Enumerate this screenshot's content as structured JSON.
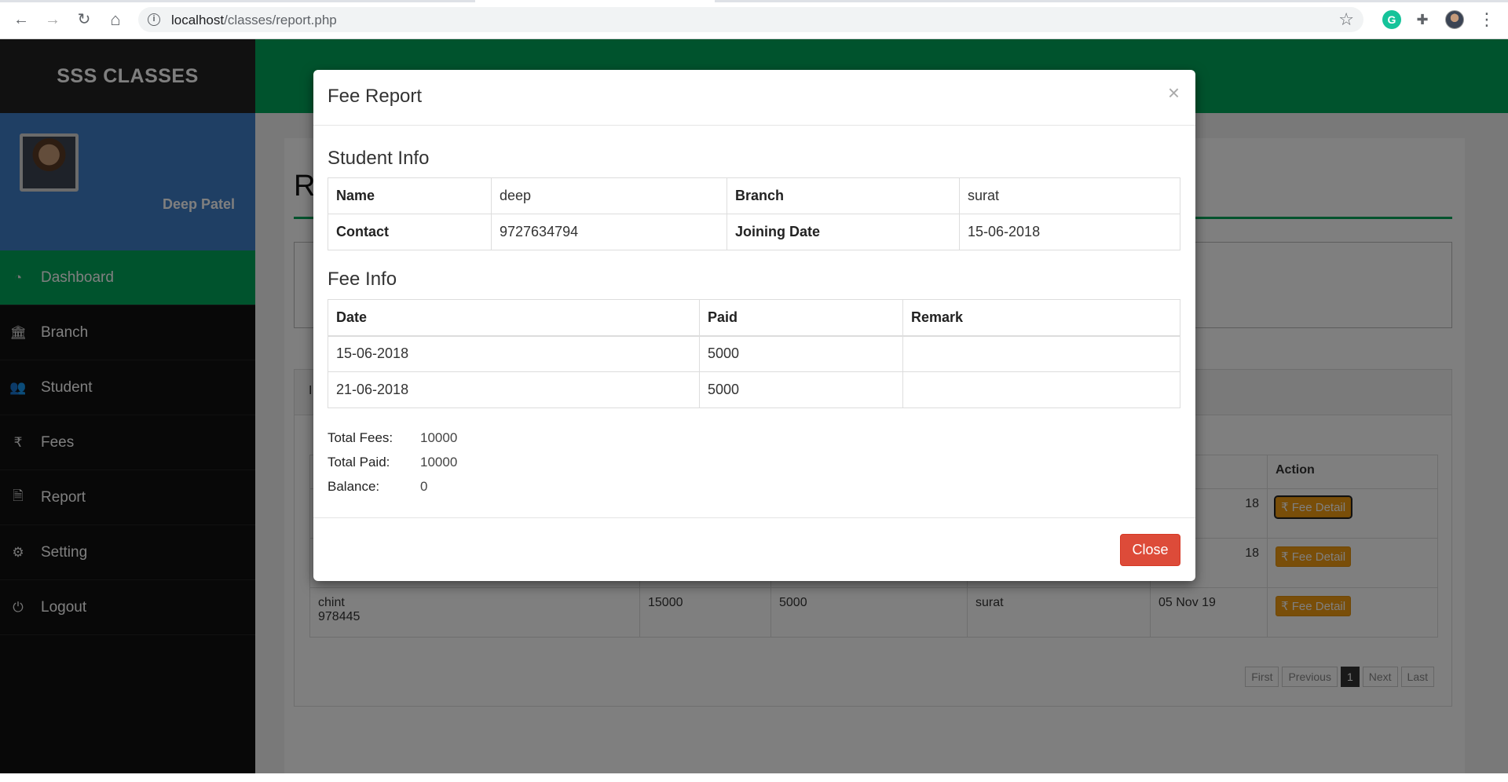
{
  "browser": {
    "url_host": "localhost",
    "url_path": "/classes/report.php",
    "back_icon": "←",
    "forward_icon": "→",
    "reload_icon": "↻",
    "home_icon": "⌂",
    "star_icon": "☆",
    "menu_icon": "⋮",
    "grammarly_label": "G",
    "extensions_icon": "✚"
  },
  "sidebar": {
    "brand": "SSS CLASSES",
    "user_name": "Deep Patel",
    "items": [
      {
        "label": "Dashboard",
        "icon": "◔"
      },
      {
        "label": "Branch",
        "icon": "🏛"
      },
      {
        "label": "Student",
        "icon": "👥"
      },
      {
        "label": "Fees",
        "icon": "₹"
      },
      {
        "label": "Report",
        "icon": "🗎"
      },
      {
        "label": "Setting",
        "icon": "⚙"
      },
      {
        "label": "Logout",
        "icon": "⏻"
      }
    ]
  },
  "background": {
    "page_title_initial": "R",
    "list_tab_initial": "I",
    "table_headers": [
      "",
      "",
      "",
      "",
      "",
      "Action"
    ],
    "rows": [
      {
        "name": "",
        "fees": "",
        "paid": "",
        "branch": "",
        "date": "18",
        "action": "Fee Detail"
      },
      {
        "name": "",
        "fees": "",
        "paid": "",
        "branch": "",
        "date": "18",
        "action": "Fee Detail"
      },
      {
        "name": "chint",
        "contact": "978445",
        "fees": "15000",
        "paid": "5000",
        "branch": "surat",
        "date": "05 Nov 19",
        "action": "Fee Detail"
      }
    ],
    "pager": [
      "First",
      "Previous",
      "1",
      "Next",
      "Last"
    ]
  },
  "modal": {
    "title": "Fee Report",
    "close_x": "×",
    "student_info_title": "Student Info",
    "student": {
      "name_label": "Name",
      "name": "deep",
      "branch_label": "Branch",
      "branch": "surat",
      "contact_label": "Contact",
      "contact": "9727634794",
      "joining_label": "Joining Date",
      "joining": "15-06-2018"
    },
    "fee_info_title": "Fee Info",
    "fee_headers": [
      "Date",
      "Paid",
      "Remark"
    ],
    "fee_rows": [
      {
        "date": "15-06-2018",
        "paid": "5000",
        "remark": ""
      },
      {
        "date": "21-06-2018",
        "paid": "5000",
        "remark": ""
      }
    ],
    "totals": {
      "total_fees_label": "Total Fees:",
      "total_fees": "10000",
      "total_paid_label": "Total Paid:",
      "total_paid": "10000",
      "balance_label": "Balance:",
      "balance": "0"
    },
    "close_button": "Close"
  },
  "colors": {
    "green": "#00a65a",
    "sidebar_blue": "#3f7ec9",
    "fee_button": "#f39c12",
    "close_button": "#dd4b39"
  }
}
